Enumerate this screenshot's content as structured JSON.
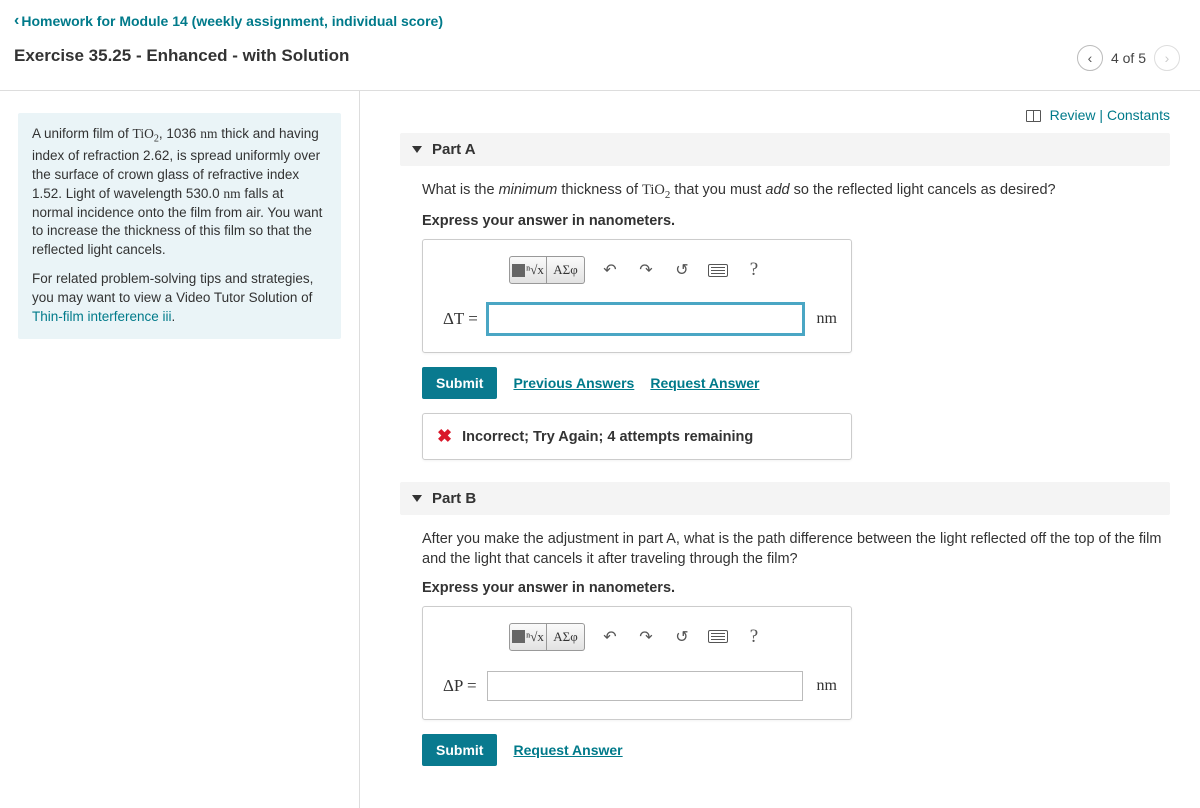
{
  "breadcrumb": {
    "label": "Homework for Module 14 (weekly assignment, individual score)"
  },
  "exercise": {
    "title": "Exercise 35.25 - Enhanced - with Solution"
  },
  "pager": {
    "position": "4 of 5"
  },
  "topLinks": {
    "review": "Review",
    "constants": "Constants"
  },
  "problem": {
    "p1a": "A uniform film of ",
    "p1chem": "TiO",
    "p1sub": "2",
    "p1b": ", 1036 ",
    "p1nm": "nm",
    "p1c": " thick and having index of refraction 2.62, is spread uniformly over the surface of crown glass of refractive index 1.52. Light of wavelength 530.0 ",
    "p1nm2": "nm",
    "p1d": " falls at normal incidence onto the film from air. You want to increase the thickness of this film so that the reflected light cancels.",
    "p2a": "For related problem-solving tips and strategies, you may want to view a Video Tutor Solution of ",
    "p2link": "Thin-film interference iii",
    "p2b": "."
  },
  "partA": {
    "title": "Part A",
    "q_a": "What is the ",
    "q_em1": "minimum",
    "q_b": " thickness of ",
    "q_chem": "TiO",
    "q_sub": "2",
    "q_c": " that you must ",
    "q_em2": "add",
    "q_d": " so the reflected light cancels as desired?",
    "instruction": "Express your answer in nanometers.",
    "var": "ΔT =",
    "unit": "nm",
    "submit": "Submit",
    "prev": "Previous Answers",
    "request": "Request Answer",
    "feedback": "Incorrect; Try Again; 4 attempts remaining"
  },
  "partB": {
    "title": "Part B",
    "question": "After you make the adjustment in part A, what is the path difference between the light reflected off the top of the film and the light that cancels it after traveling through the film?",
    "instruction": "Express your answer in nanometers.",
    "var": "ΔP =",
    "unit": "nm",
    "submit": "Submit",
    "request": "Request Answer"
  },
  "toolbar": {
    "sqrt": "ⁿ√x",
    "greek": "ΑΣφ",
    "help": "?"
  }
}
